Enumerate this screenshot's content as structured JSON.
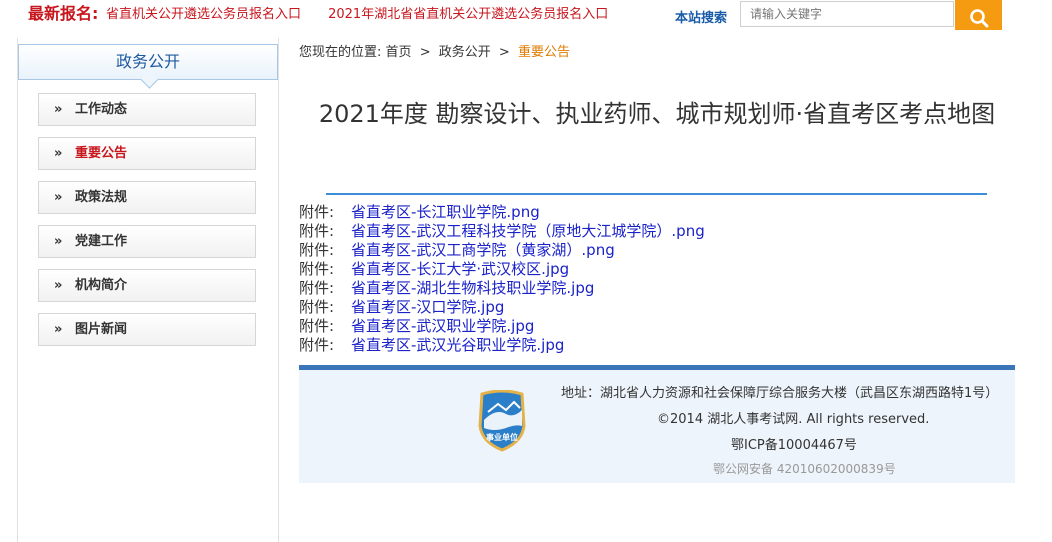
{
  "topbar": {
    "latest_label": "最新报名:",
    "marquee": [
      "省直机关公开遴选公务员报名入口",
      "2021年湖北省省直机关公开遴选公务员报名入口"
    ],
    "search_label": "本站搜索",
    "search_placeholder": "请输入关键字"
  },
  "sidebar": {
    "title": "政务公开",
    "items": [
      {
        "label": "工作动态",
        "active": false
      },
      {
        "label": "重要公告",
        "active": true
      },
      {
        "label": "政策法规",
        "active": false
      },
      {
        "label": "党建工作",
        "active": false
      },
      {
        "label": "机构简介",
        "active": false
      },
      {
        "label": "图片新闻",
        "active": false
      }
    ],
    "chevron": "»"
  },
  "breadcrumb": {
    "prefix": "您现在的位置:",
    "home": "首页",
    "section": "政务公开",
    "current": "重要公告",
    "sep": ">"
  },
  "article": {
    "title": "2021年度 勘察设计、执业药师、城市规划师·省直考区考点地图",
    "attachment_prefix": "附件:",
    "attachments": [
      "省直考区-长江职业学院.png",
      "省直考区-武汉工程科技学院（原地大江城学院）.png",
      "省直考区-武汉工商学院（黄家湖）.png",
      "省直考区-长江大学·武汉校区.jpg",
      "省直考区-湖北生物科技职业学院.jpg",
      "省直考区-汉口学院.jpg",
      "省直考区-武汉职业学院.jpg",
      "省直考区-武汉光谷职业学院.jpg"
    ]
  },
  "footer": {
    "address": "地址：湖北省人力资源和社会保障厅综合服务大楼（武昌区东湖西路特1号）",
    "copyright": "©2014 湖北人事考试网. All rights reserved.",
    "icp": "鄂ICP备10004467号",
    "police": "鄂公网安备 42010602000839号",
    "badge_text": "事业单位"
  },
  "colors": {
    "accent_red": "#c8161d",
    "link_blue": "#1a22c8",
    "footer_border": "#3a74b9",
    "search_button": "#f49b12"
  },
  "icons": [
    "search-icon",
    "chevron-icon",
    "public-institution-badge"
  ]
}
